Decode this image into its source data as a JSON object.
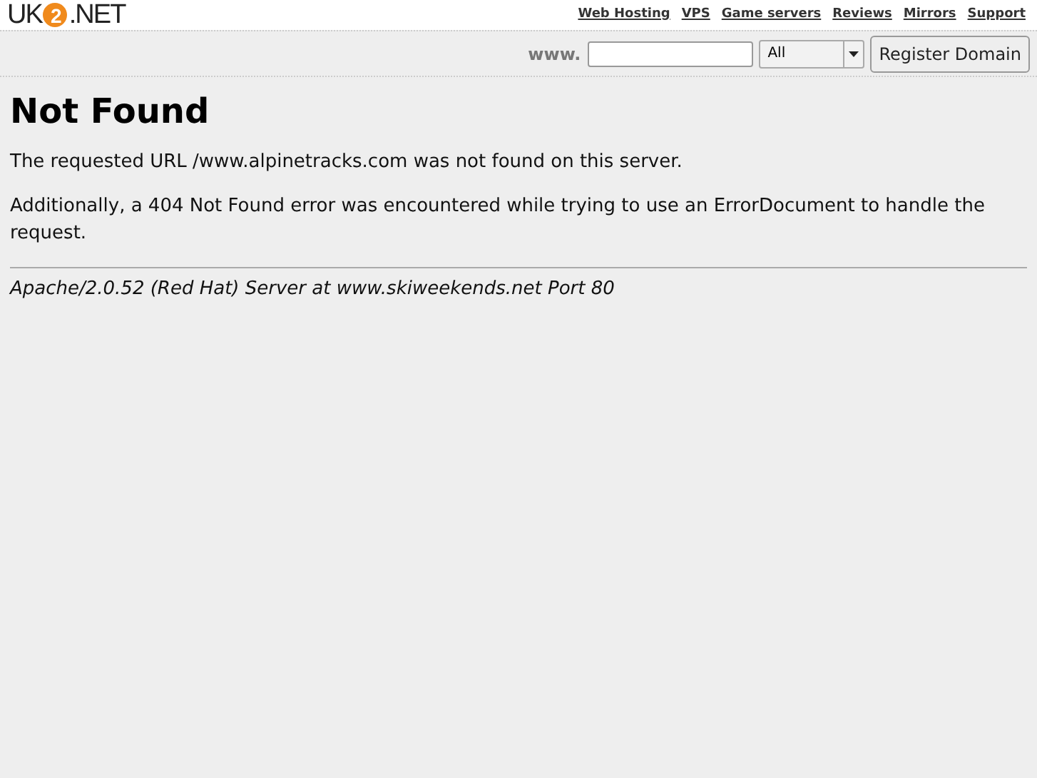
{
  "header": {
    "logo": {
      "left": "UK",
      "badge": "2",
      "right": ".NET"
    },
    "nav_links": [
      "Web Hosting",
      "VPS",
      "Game servers",
      "Reviews",
      "Mirrors",
      "Support"
    ]
  },
  "domain_search": {
    "prefix": "www.",
    "tld_select": "All",
    "button": "Register Domain"
  },
  "error_page": {
    "title": "Not Found",
    "paragraphs": [
      "The requested URL /www.alpinetracks.com was not found on this server.",
      "Additionally, a 404 Not Found error was encountered while trying to use an ErrorDocument to handle the request."
    ],
    "signature": "Apache/2.0.52 (Red Hat) Server at www.skiweekends.net Port 80"
  }
}
